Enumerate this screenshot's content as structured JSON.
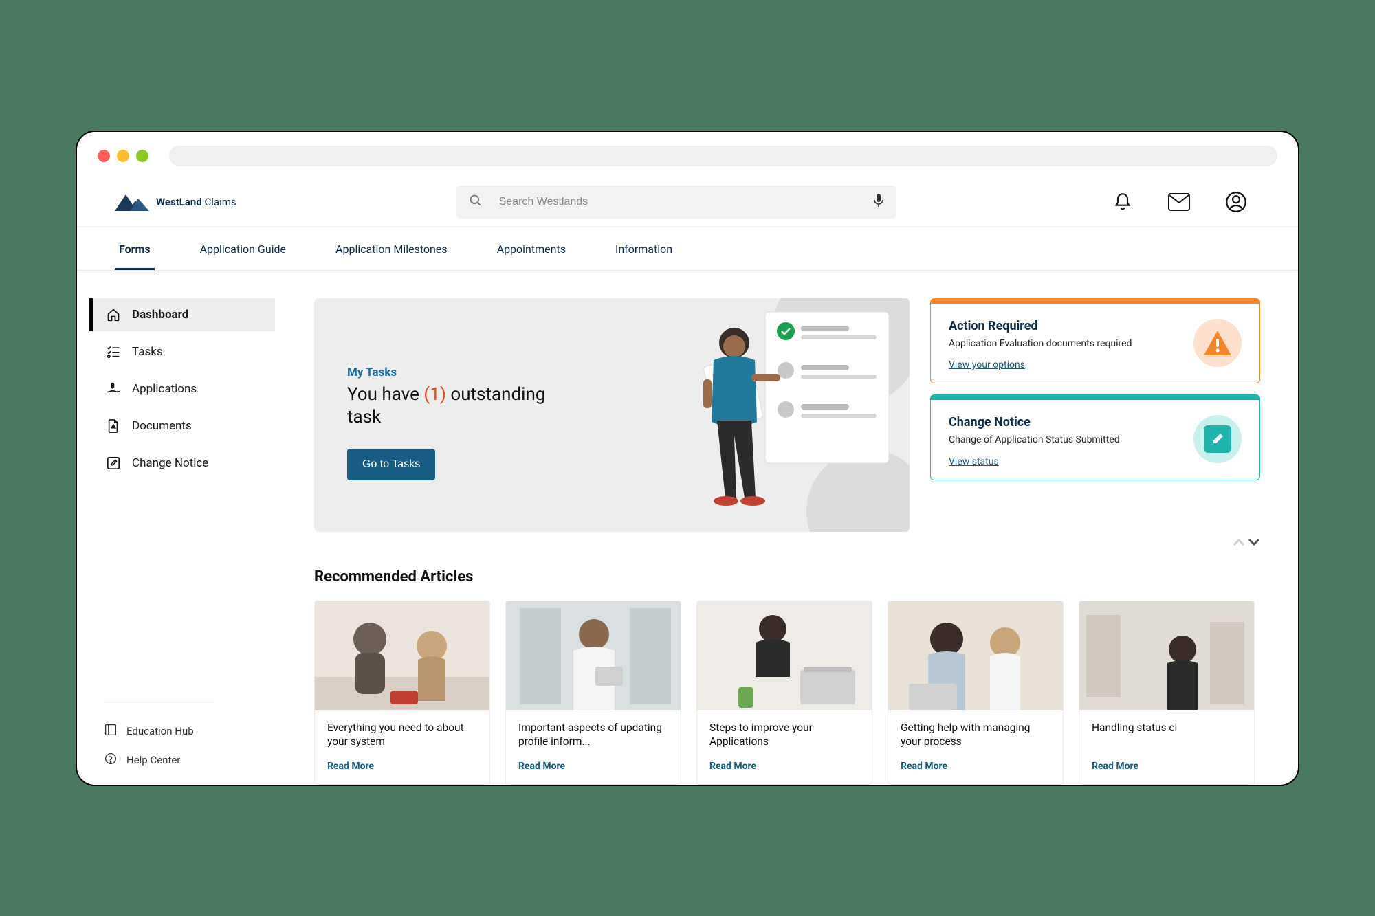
{
  "brand": {
    "name_bold": "WestLand",
    "name_rest": " Claims"
  },
  "search": {
    "placeholder": "Search Westlands"
  },
  "tabs": {
    "items": [
      {
        "label": "Forms"
      },
      {
        "label": "Application Guide"
      },
      {
        "label": "Application Milestones"
      },
      {
        "label": "Appointments"
      },
      {
        "label": "Information"
      }
    ]
  },
  "sidebar": {
    "items": [
      {
        "label": "Dashboard"
      },
      {
        "label": "Tasks"
      },
      {
        "label": "Applications"
      },
      {
        "label": "Documents"
      },
      {
        "label": "Change Notice"
      }
    ],
    "footer": [
      {
        "label": "Education Hub"
      },
      {
        "label": "Help Center"
      }
    ]
  },
  "tasks_panel": {
    "eyebrow": "My Tasks",
    "headline_pre": "You have ",
    "count": "(1)",
    "headline_post": " outstanding task",
    "cta": "Go to Tasks"
  },
  "notices": {
    "action": {
      "title": "Action Required",
      "desc": "Application Evaluation documents required",
      "link": "View your options"
    },
    "change": {
      "title": "Change Notice",
      "desc": "Change of Application Status Submitted",
      "link": "View status"
    }
  },
  "articles": {
    "heading": "Recommended Articles",
    "read_more": "Read More",
    "items": [
      {
        "title": "Everything you need to about your system"
      },
      {
        "title": "Important aspects of updating profile inform..."
      },
      {
        "title": "Steps to improve your Applications"
      },
      {
        "title": "Getting help with managing your process"
      },
      {
        "title": "Handling status cl"
      }
    ]
  }
}
